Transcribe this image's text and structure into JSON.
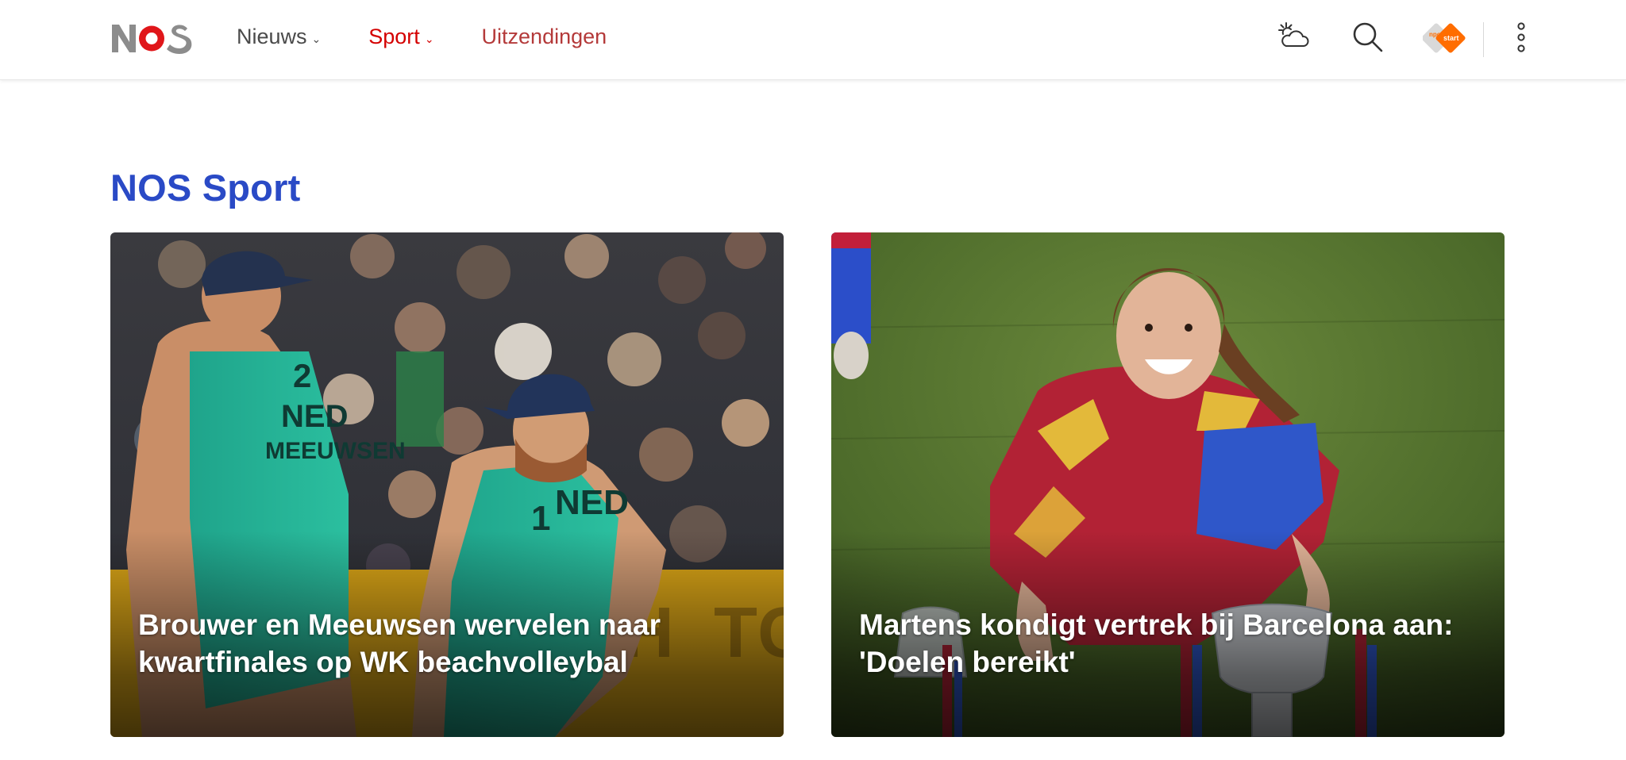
{
  "brand": {
    "logo_text": "NOS",
    "accent": "#d40000",
    "title_color": "#2a4ac6"
  },
  "nav": {
    "items": [
      {
        "label": "Nieuws",
        "has_dropdown": true
      },
      {
        "label": "Sport",
        "has_dropdown": true
      },
      {
        "label": "Uitzendingen",
        "has_dropdown": false
      }
    ]
  },
  "header_icons": {
    "weather": "weather-icon",
    "search": "search-icon",
    "npo": "npo-start-icon",
    "npo_label": "start",
    "more": "more-vertical-icon"
  },
  "page": {
    "title": "NOS Sport"
  },
  "articles": [
    {
      "headline": "Brouwer en Meeuwsen wervelen naar kwartfinales op WK beachvolleybal"
    },
    {
      "headline": "Martens kondigt vertrek bij Barcelona aan: 'Doelen bereikt'"
    }
  ]
}
